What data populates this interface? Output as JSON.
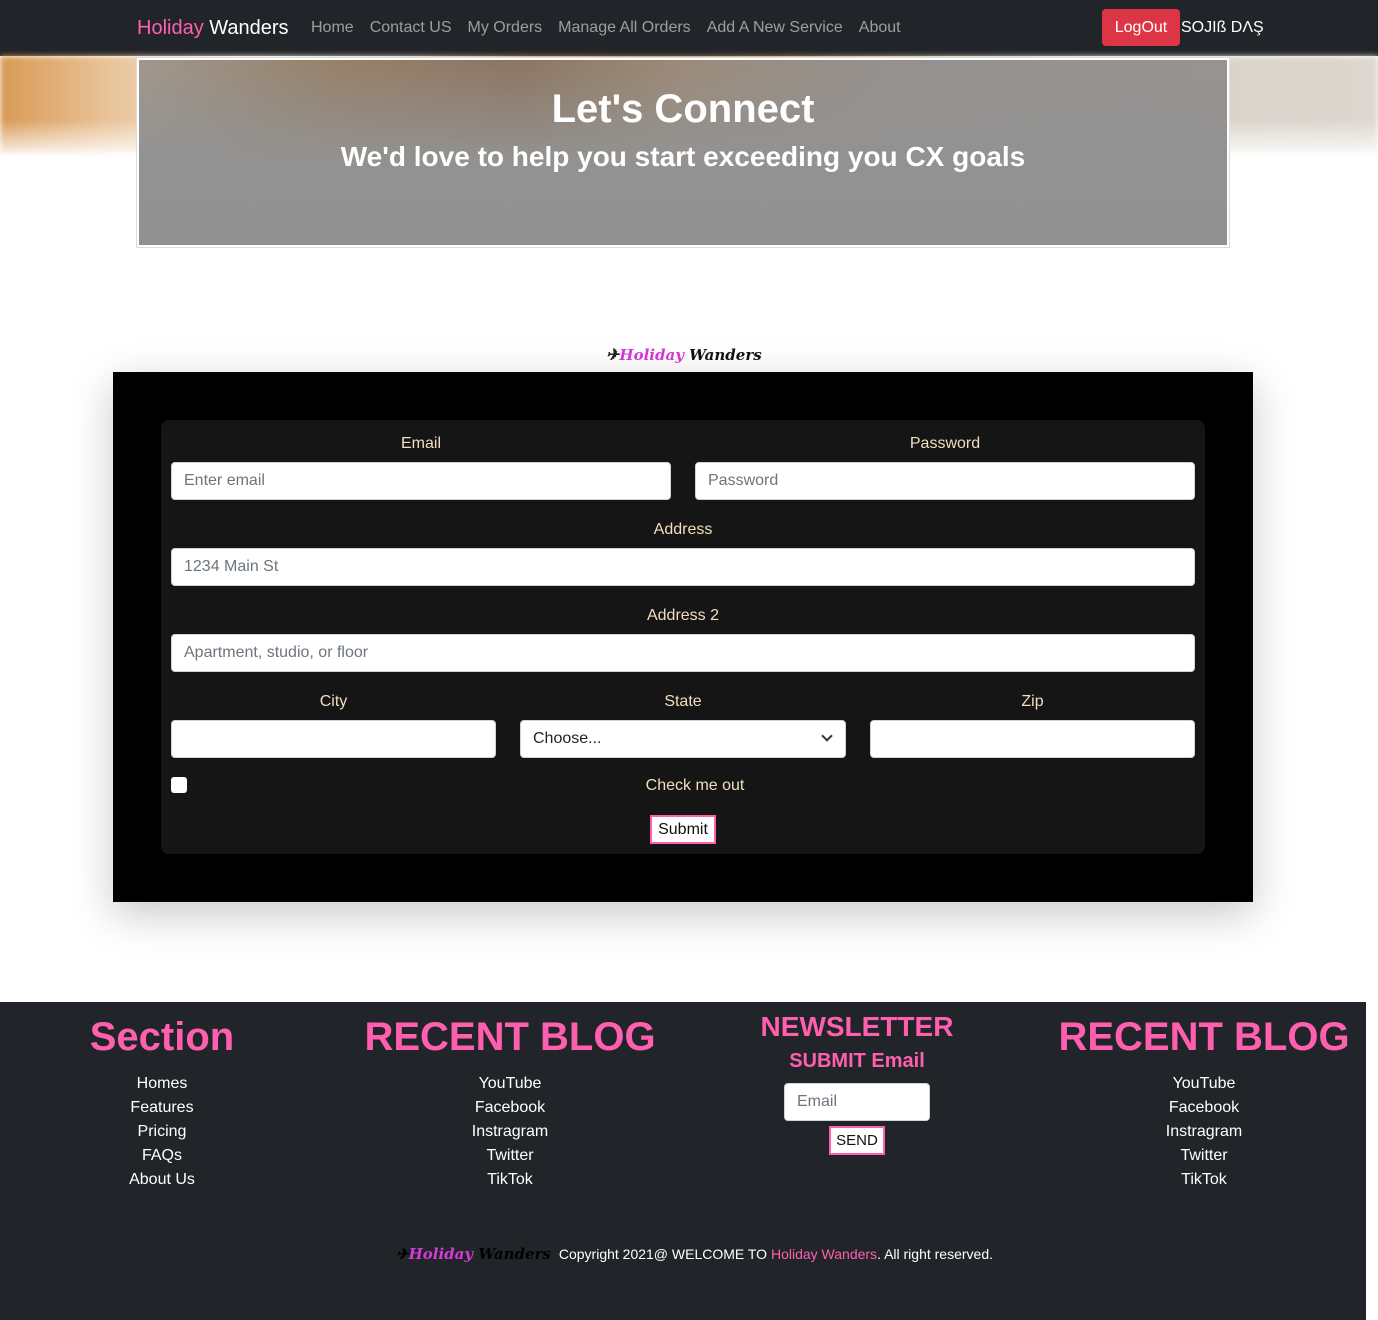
{
  "navbar": {
    "brand_part1": "Holiday",
    "brand_part2": "Wanders",
    "links": [
      "Home",
      "Contact US",
      "My Orders",
      "Manage All Orders",
      "Add A New Service",
      "About"
    ],
    "logout_label": "LogOut",
    "user_name": "SOJIß DΛŞ"
  },
  "hero": {
    "title": "Let's Connect",
    "subtitle": "We'd love to help you start exceeding you CX goals"
  },
  "logo": {
    "plane_icon": "airplane-icon",
    "part1": "Holiday",
    "part2": "Wanders"
  },
  "form": {
    "email_label": "Email",
    "email_placeholder": "Enter email",
    "password_label": "Password",
    "password_placeholder": "Password",
    "address_label": "Address",
    "address_placeholder": "1234 Main St",
    "address2_label": "Address 2",
    "address2_placeholder": "Apartment, studio, or floor",
    "city_label": "City",
    "state_label": "State",
    "state_selected": "Choose...",
    "zip_label": "Zip",
    "check_label": "Check me out",
    "submit_label": "Submit"
  },
  "footer": {
    "col1_title": "Section",
    "col1_links": [
      "Homes",
      "Features",
      "Pricing",
      "FAQs",
      "About Us"
    ],
    "col2_title": "RECENT BLOG",
    "col2_links": [
      "YouTube",
      "Facebook",
      "Instragram",
      "Twitter",
      "TikTok"
    ],
    "newsletter_title": "NEWSLETTER",
    "newsletter_sub": "SUBMIT Email",
    "newsletter_placeholder": "Email",
    "send_label": "SEND",
    "col4_title": "RECENT BLOG",
    "col4_links": [
      "YouTube",
      "Facebook",
      "Instragram",
      "Twitter",
      "TikTok"
    ],
    "copyright_prefix": "Copyright 2021@ WELCOME TO",
    "copyright_brand": "Holiday Wanders",
    "copyright_suffix": ". All right reserved."
  },
  "colors": {
    "accent_pink": "#ff5fae",
    "logout_red": "#dc3545",
    "navbar_bg": "#212529",
    "label_cream": "#f3dfbe"
  }
}
